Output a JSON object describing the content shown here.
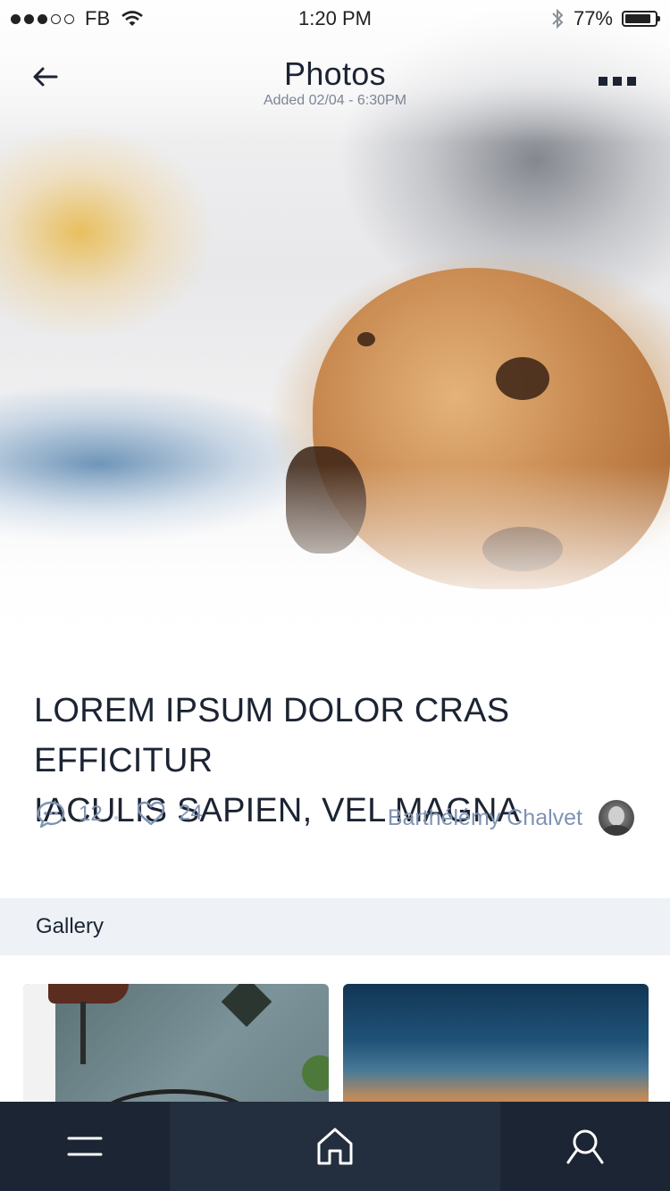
{
  "status_bar": {
    "carrier": "FB",
    "time": "1:20 PM",
    "battery": "77%",
    "signal_bars": 3,
    "signal_total": 5
  },
  "nav": {
    "title": "Photos",
    "subtitle": "Added 02/04 - 6:30PM"
  },
  "article": {
    "headline_line1": "LOREM IPSUM DOLOR CRAS EFFICITUR",
    "headline_line2": "IACULIS SAPIEN, VEL MAGNA",
    "comments_count": "12",
    "likes_count": "24",
    "author": "Barthélémy Chalvet"
  },
  "gallery": {
    "title": "Gallery"
  },
  "colors": {
    "dark": "#1c2433",
    "meta": "#7f93b3",
    "gallery_bg": "#eef1f6",
    "tabbar": "#1c2533",
    "tabbar_active": "#232e3e"
  },
  "icons": {
    "back": "arrow-left-icon",
    "more": "more-dots-icon",
    "comments": "chat-bubble-icon",
    "likes": "heart-icon",
    "menu": "hamburger-icon",
    "home": "home-icon",
    "search": "search-icon"
  }
}
